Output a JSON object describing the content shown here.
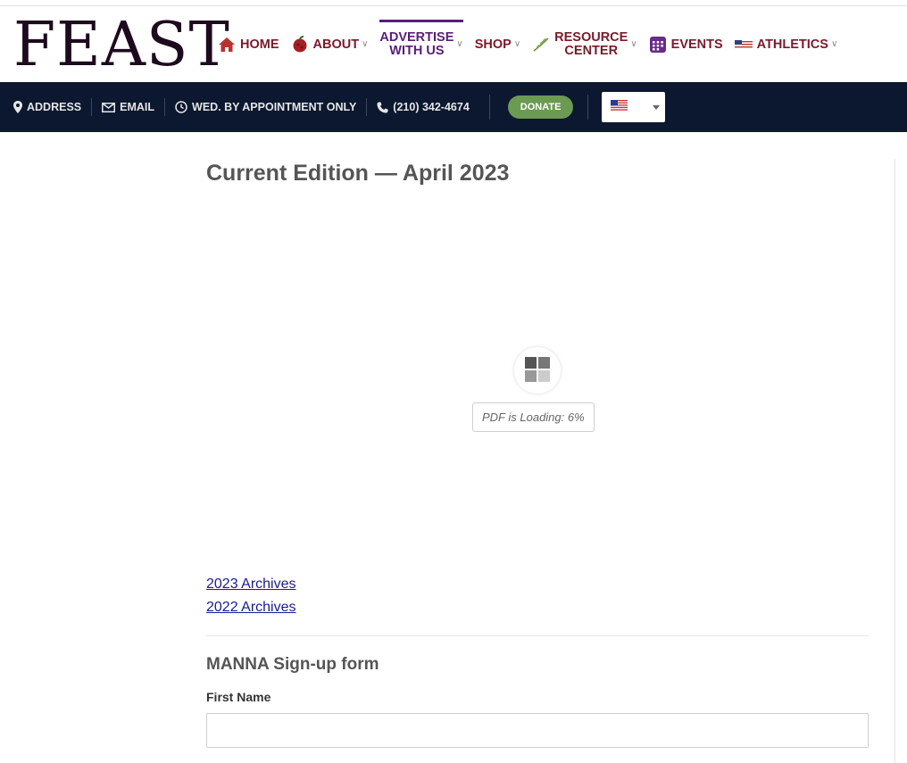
{
  "brand": {
    "logo_text": "FEAST"
  },
  "nav": {
    "items": [
      {
        "label": "HOME",
        "icon": "home-icon"
      },
      {
        "label": "ABOUT",
        "icon": "apple-icon"
      },
      {
        "label_line1": "ADVERTISE",
        "label_line2": "WITH US"
      },
      {
        "label": "SHOP"
      },
      {
        "label_line1": "RESOURCE",
        "label_line2": "CENTER",
        "icon": "leaf-icon"
      },
      {
        "label": "EVENTS",
        "icon": "calendar-icon"
      },
      {
        "label": "ATHLETICS",
        "icon": "flag-icon"
      }
    ]
  },
  "topbar": {
    "address": "ADDRESS",
    "email": "EMAIL",
    "hours": "WED. BY APPOINTMENT ONLY",
    "phone": "(210) 342-4674",
    "donate": "DONATE",
    "language_flag": "us-flag-icon"
  },
  "main": {
    "title": "Current Edition —  April 2023",
    "pdf_status": "PDF is Loading: 6%",
    "pdf_progress": 6,
    "archive_links": [
      "2023 Archives",
      "2022 Archives"
    ],
    "form_title": "MANNA Sign-up form",
    "first_name_label": "First Name",
    "first_name_value": ""
  },
  "colors": {
    "nav_text": "#7a1a2a",
    "nav_active": "#5a1e7a",
    "bar_bg": "#0c1730",
    "donate_bg": "#6b9a52",
    "link": "#1a1a9a"
  }
}
